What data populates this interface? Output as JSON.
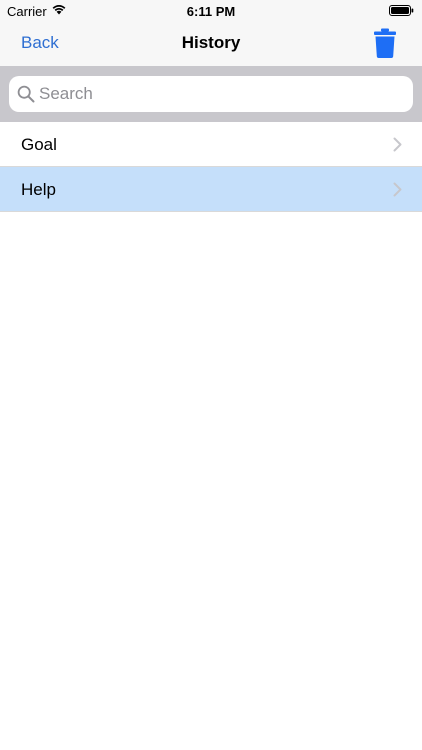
{
  "status_bar": {
    "carrier": "Carrier",
    "time": "6:11 PM"
  },
  "nav": {
    "back_label": "Back",
    "title": "History",
    "trash_icon": "trash-icon"
  },
  "search": {
    "placeholder": "Search",
    "value": ""
  },
  "list": {
    "items": [
      {
        "label": "Goal",
        "selected": false
      },
      {
        "label": "Help",
        "selected": true
      }
    ]
  },
  "colors": {
    "accent": "#2f6fd2",
    "trash": "#1e6ef5",
    "selected_row": "#c5dffa",
    "search_bar_bg": "#c8c7cc"
  }
}
